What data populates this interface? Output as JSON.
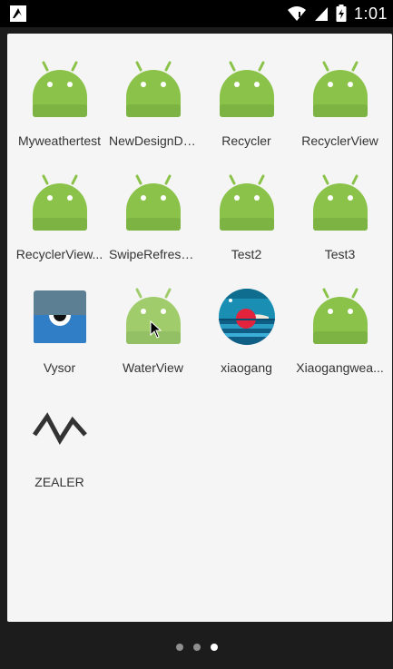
{
  "status_bar": {
    "time": "1:01",
    "icons": [
      "notification-icon",
      "wifi-icon",
      "signal-icon",
      "battery-charging-icon"
    ]
  },
  "apps": [
    {
      "label": "Myweathertest",
      "icon": "android-icon"
    },
    {
      "label": "NewDesignDe...",
      "icon": "android-icon"
    },
    {
      "label": "Recycler",
      "icon": "android-icon"
    },
    {
      "label": "RecyclerView",
      "icon": "android-icon"
    },
    {
      "label": "RecyclerView...",
      "icon": "android-icon"
    },
    {
      "label": "SwipeRefresh...",
      "icon": "android-icon"
    },
    {
      "label": "Test2",
      "icon": "android-icon"
    },
    {
      "label": "Test3",
      "icon": "android-icon"
    },
    {
      "label": "Vysor",
      "icon": "vysor-icon"
    },
    {
      "label": "WaterView",
      "icon": "android-icon"
    },
    {
      "label": "xiaogang",
      "icon": "xiaogang-icon"
    },
    {
      "label": "Xiaogangwea...",
      "icon": "android-icon"
    },
    {
      "label": "ZEALER",
      "icon": "zealer-icon"
    }
  ],
  "page_indicator": {
    "pages": 3,
    "current": 3
  },
  "colors": {
    "android_green": "#8bc34a",
    "drawer_bg": "#f5f5f5",
    "status_bar": "#000000",
    "nav_bg": "#1c1c1c"
  }
}
